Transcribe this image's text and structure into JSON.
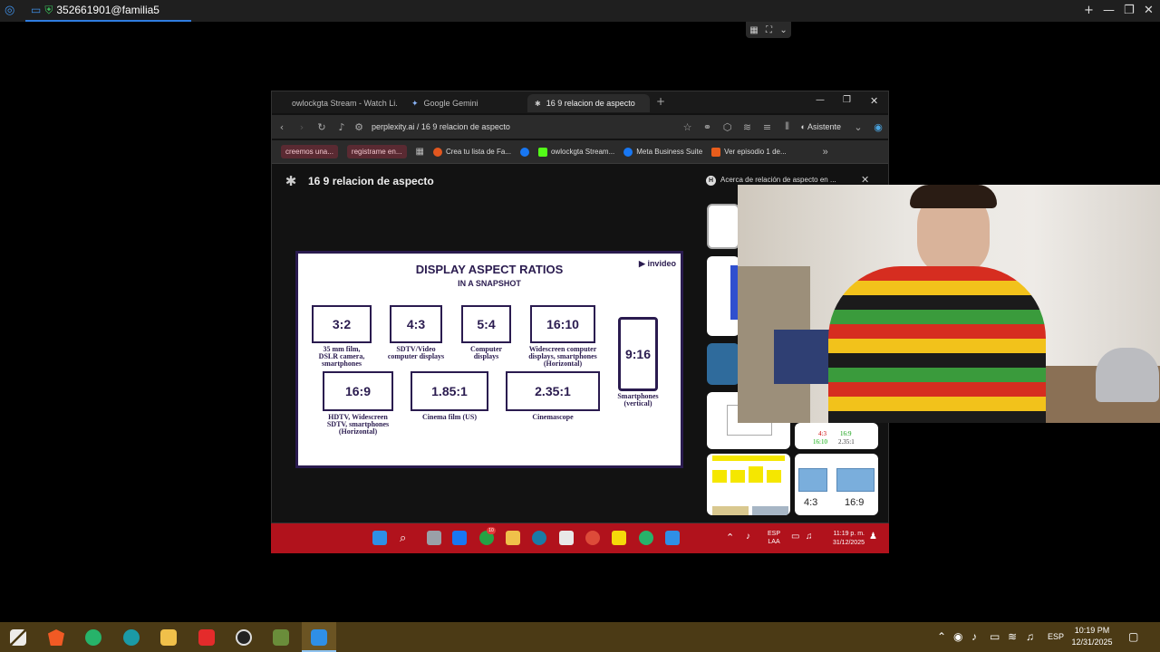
{
  "remote": {
    "session_title": "352661901@familia5",
    "win_controls": [
      "+",
      "—",
      "❐",
      "✕"
    ]
  },
  "browser": {
    "tabs": [
      {
        "label": "owlockgta Stream - Watch Li..."
      },
      {
        "label": "Google Gemini"
      },
      {
        "label": "16 9 relacion de aspecto"
      }
    ],
    "new_tab": "+",
    "controls": [
      "—",
      "❐",
      "✕"
    ],
    "url": "perplexity.ai / 16 9 relacion de aspecto",
    "assistant_label": "Asistente",
    "bookmarks": [
      {
        "label": "creemos una...",
        "pill": true
      },
      {
        "label": "registrame en...",
        "pill": true
      },
      {
        "label": "Crea tu lista de Fa...",
        "pill": false,
        "color": "#e2571f"
      },
      {
        "label": "",
        "pill": false,
        "color": "#1877f2"
      },
      {
        "label": "owlockgta Stream...",
        "pill": false,
        "color": "#53fc18"
      },
      {
        "label": "Meta Business Suite",
        "pill": false,
        "color": "#1877f2"
      },
      {
        "label": "Ver episodio 1 de...",
        "pill": false,
        "color": "#e85d1c"
      }
    ],
    "more_bookmarks": "»"
  },
  "page": {
    "title": "16 9 relacion de aspecto",
    "side_panel_badge": "H",
    "side_panel_title": "Acerca de relación de aspecto en ...",
    "side_close": "✕"
  },
  "slide": {
    "brand": "invideo",
    "title": "DISPLAY ASPECT RATIOS",
    "subtitle": "IN A SNAPSHOT",
    "ratios": [
      {
        "ratio": "3:2",
        "caption": "35 mm film,\nDSLR camera,\nsmartphones"
      },
      {
        "ratio": "4:3",
        "caption": "SDTV/Video\ncomputer displays"
      },
      {
        "ratio": "5:4",
        "caption": "Computer\ndisplays"
      },
      {
        "ratio": "16:10",
        "caption": "Widescreen computer\ndisplays, smartphones\n(Horizontal)"
      },
      {
        "ratio": "9:16",
        "caption": "Smartphones\n(vertical)"
      },
      {
        "ratio": "16:9",
        "caption": "HDTV, Widescreen\nSDTV, smartphones\n(Horizontal)"
      },
      {
        "ratio": "1.85:1",
        "caption": "Cinema film (US)"
      },
      {
        "ratio": "2.35:1",
        "caption": "Cinemascope"
      }
    ]
  },
  "thumbnails": {
    "thumb_a": {
      "line1": "4:3",
      "line2": "16:9",
      "line3": "16:10",
      "line4": "2.35:1"
    },
    "thumb_b": {
      "left": "4:3",
      "right": "16:9"
    }
  },
  "inner_taskbar": {
    "lang": "ESP",
    "lang2": "LAA",
    "time": "11:19 p. m.",
    "date": "31/12/2025",
    "badge": "10"
  },
  "host_taskbar": {
    "lang": "ESP",
    "time": "10:19 PM",
    "date": "12/31/2025"
  }
}
